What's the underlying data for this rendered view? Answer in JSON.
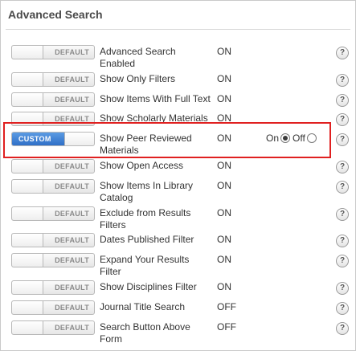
{
  "section": {
    "title": "Advanced Search"
  },
  "colors": {
    "highlight": "#e02020",
    "custom_toggle": "#3a7bd5"
  },
  "icons": {
    "help": "help-icon"
  },
  "rows": [
    {
      "label": "Advanced Search Enabled",
      "value": "ON",
      "mode": "DEFAULT"
    },
    {
      "label": "Show Only Filters",
      "value": "ON",
      "mode": "DEFAULT"
    },
    {
      "label": "Show Items With Full Text",
      "value": "ON",
      "mode": "DEFAULT"
    },
    {
      "label": "Show Scholarly Materials",
      "value": "ON",
      "mode": "DEFAULT"
    },
    {
      "label": "Show Peer Reviewed Materials",
      "value": "ON",
      "mode": "CUSTOM",
      "radio_on_label": "On",
      "radio_off_label": "Off",
      "radio_selected": "On"
    },
    {
      "label": "Show Open Access",
      "value": "ON",
      "mode": "DEFAULT"
    },
    {
      "label": "Show Items In Library Catalog",
      "value": "ON",
      "mode": "DEFAULT"
    },
    {
      "label": "Exclude from Results Filters",
      "value": "ON",
      "mode": "DEFAULT"
    },
    {
      "label": "Dates Published Filter",
      "value": "ON",
      "mode": "DEFAULT"
    },
    {
      "label": "Expand Your Results Filter",
      "value": "ON",
      "mode": "DEFAULT"
    },
    {
      "label": "Show Disciplines Filter",
      "value": "ON",
      "mode": "DEFAULT"
    },
    {
      "label": "Journal Title Search",
      "value": "OFF",
      "mode": "DEFAULT"
    },
    {
      "label": "Search Button Above Form",
      "value": "OFF",
      "mode": "DEFAULT"
    }
  ],
  "help_glyph": "?"
}
